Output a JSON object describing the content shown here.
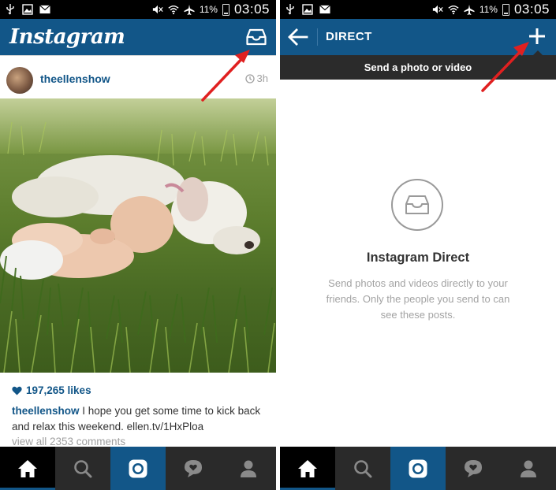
{
  "status_bar": {
    "battery_pct": "11%",
    "time": "03:05"
  },
  "feed": {
    "app_title": "Instagram",
    "post": {
      "username": "theellenshow",
      "time_ago": "3h",
      "likes": "197,265 likes",
      "caption_user": "theellenshow",
      "caption_text": " I hope you get some time to kick back and relax this weekend. ellen.tv/1HxPloa",
      "view_all": "view all 2353 comments"
    }
  },
  "direct": {
    "title": "DIRECT",
    "tooltip": "Send a photo or video",
    "empty_title": "Instagram Direct",
    "empty_desc": "Send photos and videos directly to your friends. Only the people you send to can see these posts."
  },
  "nav": [
    "home-icon",
    "search-icon",
    "camera-icon",
    "activity-icon",
    "profile-icon"
  ],
  "colors": {
    "brand_blue": "#125688",
    "status_bar": "#000000",
    "nav_bar": "#2a2a2a",
    "annotation_arrow": "#e02020"
  }
}
